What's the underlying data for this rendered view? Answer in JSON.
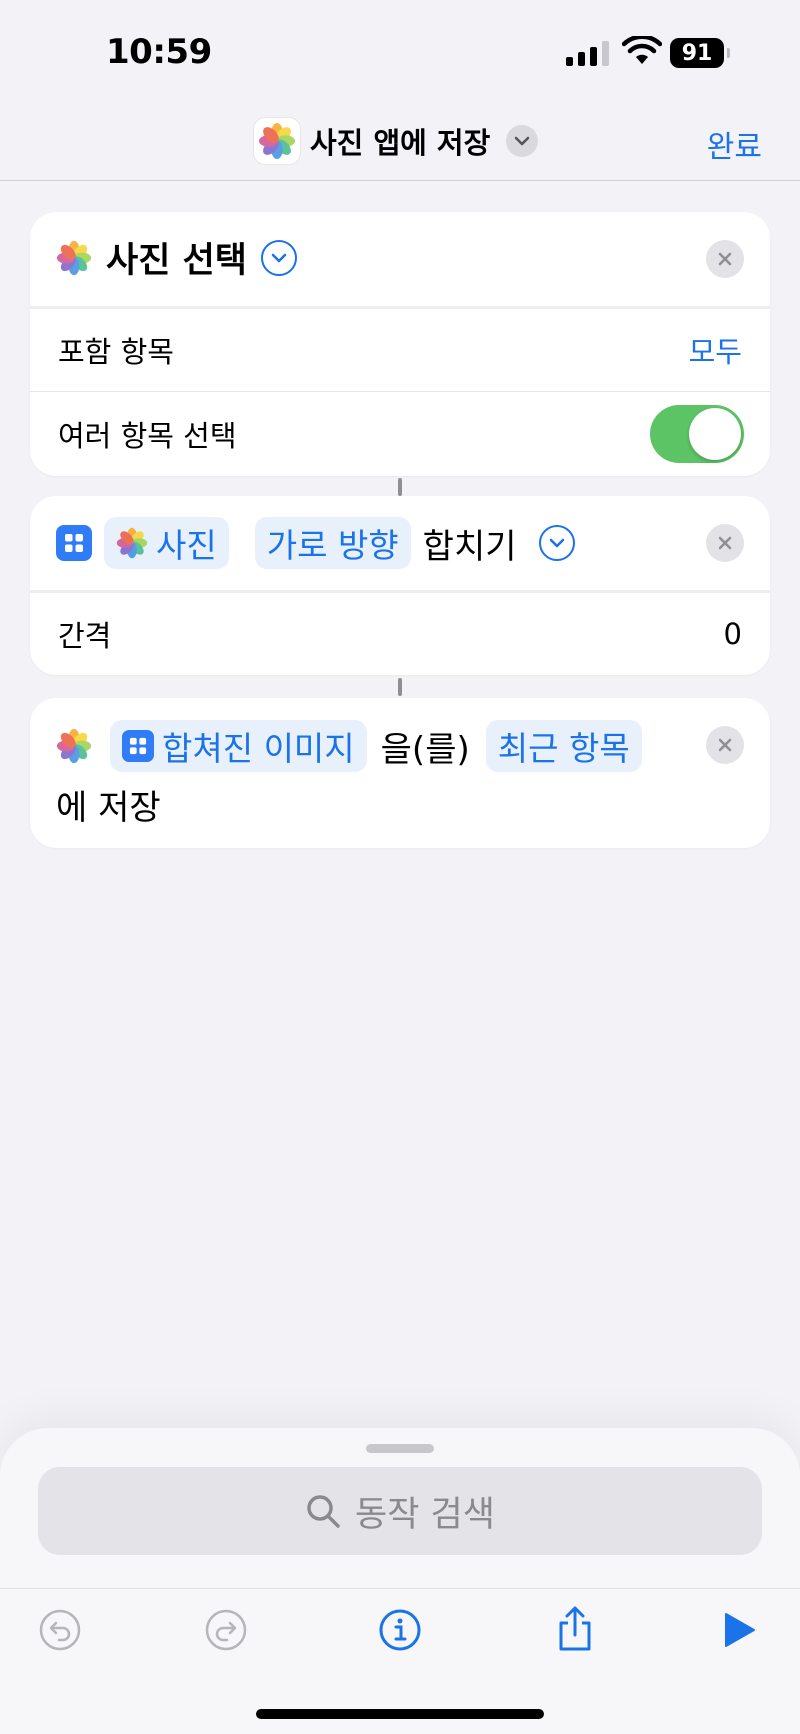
{
  "status_bar": {
    "time": "10:59",
    "battery": "91"
  },
  "nav": {
    "title": "사진 앱에 저장",
    "done": "완료"
  },
  "card1": {
    "title": "사진 선택",
    "rows": [
      {
        "label": "포함 항목",
        "value": "모두"
      },
      {
        "label": "여러 항목 선택",
        "toggle": true
      }
    ]
  },
  "card2": {
    "pill_photos": "사진",
    "pill_direction": "가로 방향",
    "action": "합치기",
    "rows": [
      {
        "label": "간격",
        "value": "0"
      }
    ]
  },
  "card3": {
    "pill_image": "합쳐진 이미지",
    "particle": "을(를)",
    "pill_album": "최근 항목",
    "tail": "에 저장"
  },
  "search": {
    "placeholder": "동작 검색"
  },
  "colors": {
    "accent": "#1a73e8",
    "toggle_on": "#5dc466",
    "pill_bg": "#e8f0fc"
  }
}
